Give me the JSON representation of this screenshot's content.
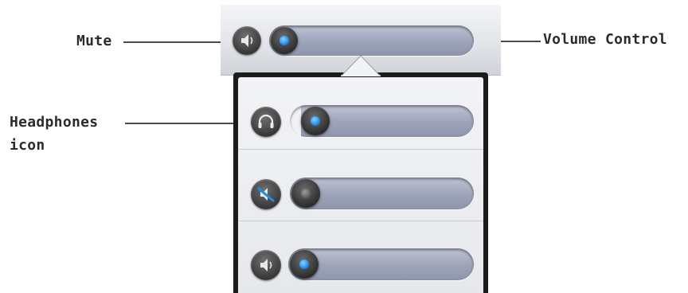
{
  "callouts": {
    "mute": "Mute",
    "volume_control": "Volume Control",
    "headphones_line1": "Headphones",
    "headphones_line2": "icon"
  },
  "sliders": {
    "main_volume": {
      "icon": "speaker-icon",
      "value": 0.0,
      "knob_color": "#1f8ff0"
    },
    "headphones": {
      "icon": "headphones-icon",
      "value": 0.0,
      "knob_color": "#1f8ff0"
    },
    "muted": {
      "icon": "muted-speaker-icon",
      "value": 0.0,
      "knob_color": "#5d5d5d"
    },
    "speaker": {
      "icon": "speaker-icon",
      "value": 0.0,
      "knob_color": "#1f8ff0"
    }
  },
  "colors": {
    "accent": "#1f8ff0",
    "mute_strike": "#1a8fe6"
  }
}
